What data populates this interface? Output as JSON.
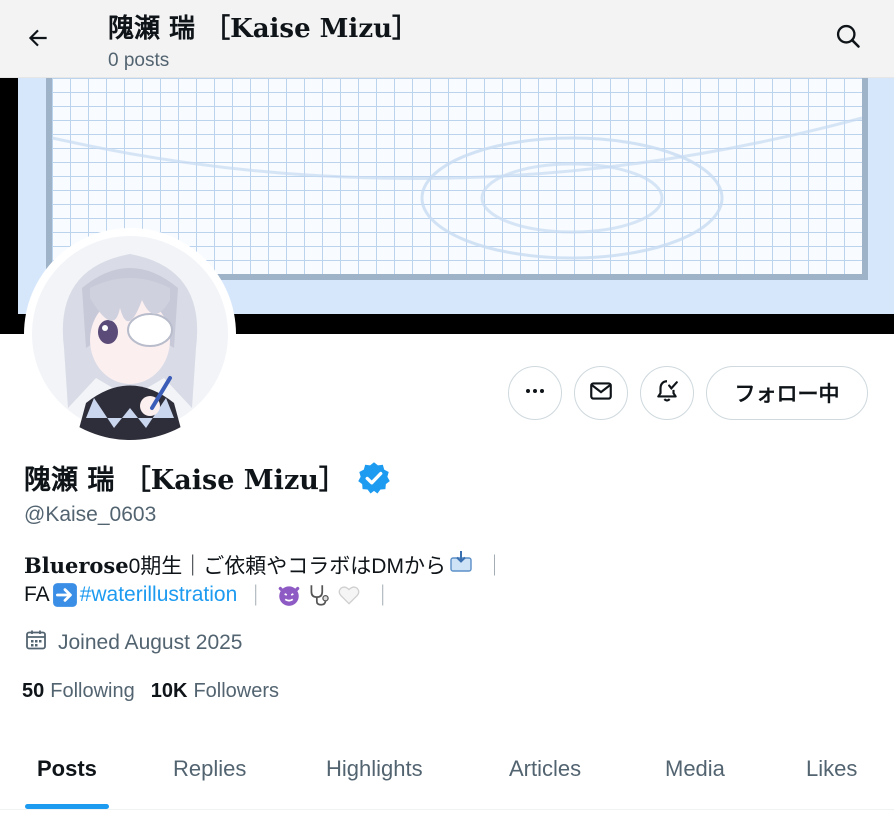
{
  "header": {
    "title": "隗瀬 瑞 ［Kaise Mizu］",
    "subtitle": "0 posts",
    "back_icon": "arrow-left-icon",
    "search_icon": "search-icon"
  },
  "profile": {
    "display_name": "隗瀬 瑞 ［Kaise Mizu］",
    "verified": true,
    "handle": "@Kaise_0603",
    "bio_line1_bold": "Bluerose",
    "bio_line1_rest": "0期生｜ご依頼やコラボはDMから",
    "bio_line2_prefix": "FA",
    "bio_hashtag": "#waterillustration",
    "bio_sep": "｜",
    "joined": "Joined August 2025",
    "following_count": "50",
    "following_label": "Following",
    "followers_count": "10K",
    "followers_label": "Followers"
  },
  "actions": {
    "more_icon": "more-icon",
    "message_icon": "mail-icon",
    "notify_icon": "bell-check-icon",
    "follow_label": "フォロー中"
  },
  "tabs": [
    "Posts",
    "Replies",
    "Highlights",
    "Articles",
    "Media",
    "Likes"
  ],
  "active_tab": "Posts",
  "colors": {
    "accent": "#1d9bf0",
    "text_primary": "#0f1419",
    "text_secondary": "#536471",
    "banner_bg": "#d7e7fb",
    "banner_frame": "#9fb3c8"
  }
}
